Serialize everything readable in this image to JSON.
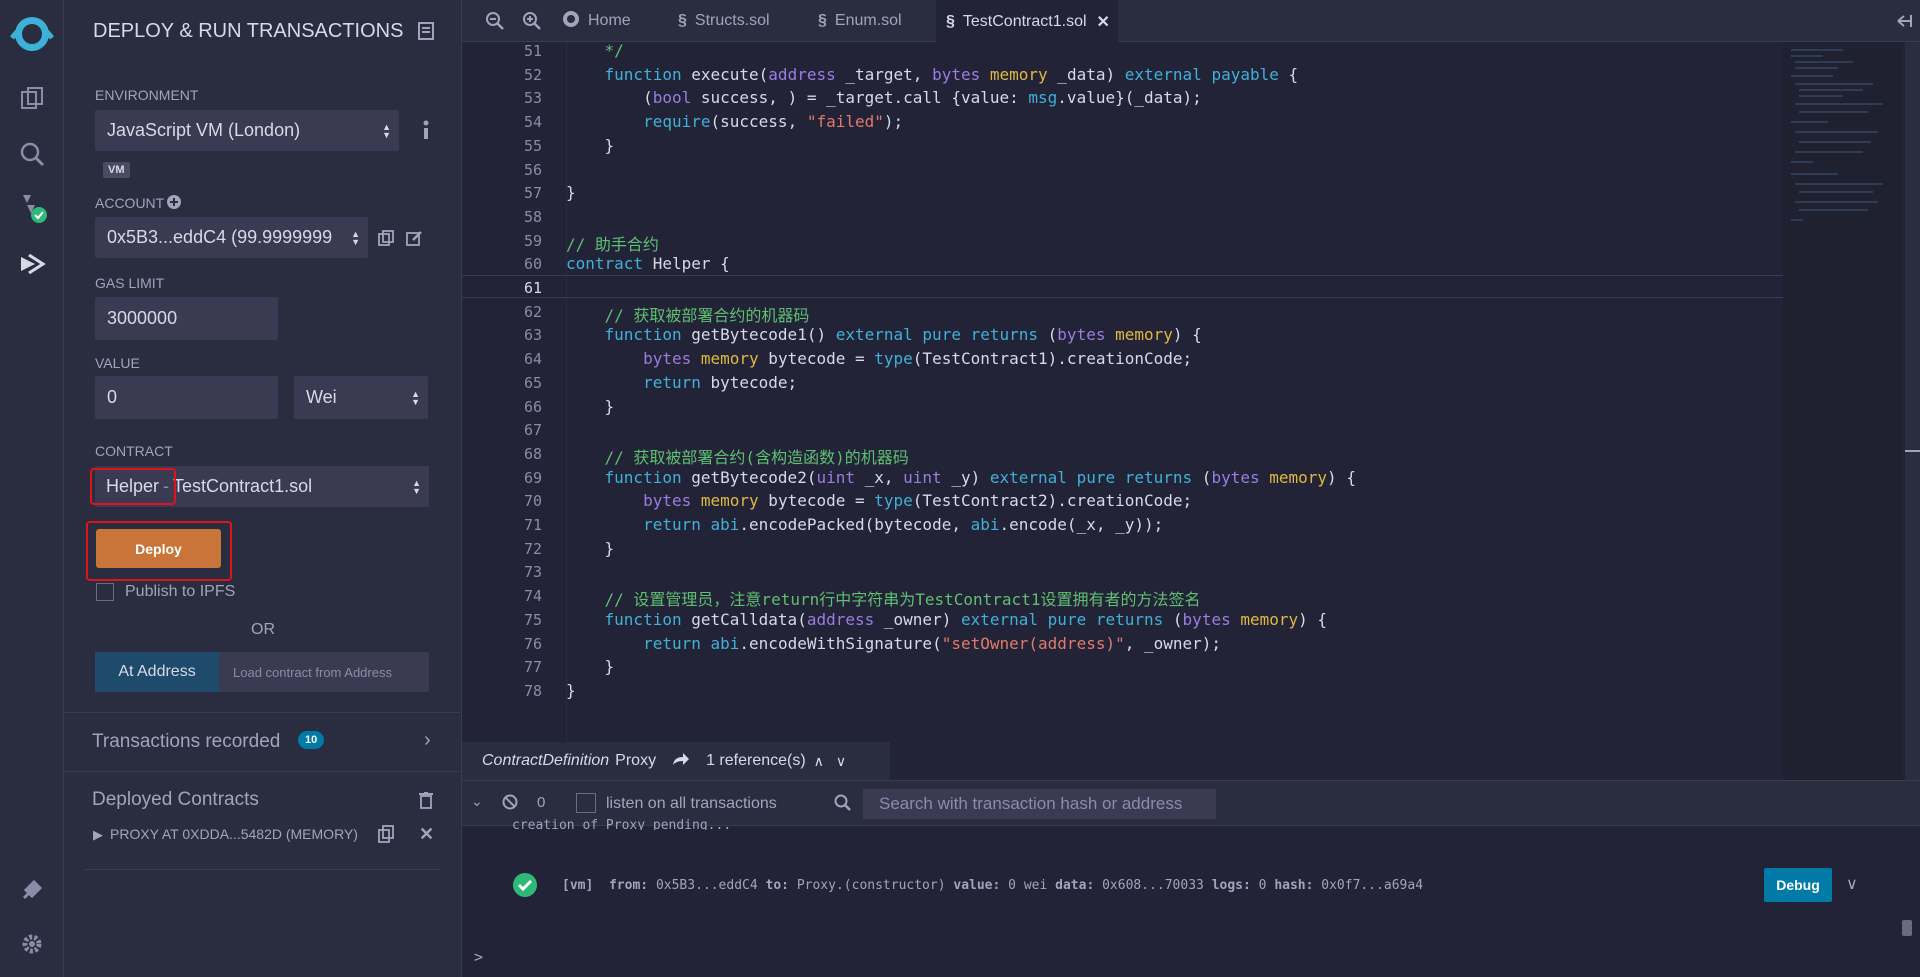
{
  "sidebar_panel": {
    "title": "DEPLOY & RUN TRANSACTIONS",
    "environment_label": "ENVIRONMENT",
    "environment_value": "JavaScript VM (London)",
    "vm_badge": "VM",
    "account_label": "ACCOUNT",
    "account_value": "0x5B3...eddC4 (99.9999999",
    "gas_limit_label": "GAS LIMIT",
    "gas_limit_value": "3000000",
    "value_label": "VALUE",
    "value_value": "0",
    "value_unit": "Wei",
    "contract_label": "CONTRACT",
    "contract_name": "Helper",
    "contract_sep": "-",
    "contract_file": "TestContract1.sol",
    "deploy_label": "Deploy",
    "publish_label": "Publish to IPFS",
    "or_label": "OR",
    "at_address_label": "At Address",
    "load_placeholder": "Load contract from Address",
    "tx_recorded_label": "Transactions recorded",
    "tx_recorded_count": "10",
    "deployed_label": "Deployed Contracts",
    "deployed_item": "PROXY AT 0XDDA...5482D (MEMORY)"
  },
  "tabs": [
    {
      "label": "Home"
    },
    {
      "label": "Structs.sol"
    },
    {
      "label": "Enum.sol"
    },
    {
      "label": "TestContract1.sol"
    }
  ],
  "editor_lines": [
    {
      "n": "51",
      "t": "    */"
    },
    {
      "n": "52",
      "t": "    function execute(address _target, bytes memory _data) external payable {"
    },
    {
      "n": "53",
      "t": "        (bool success, ) = _target.call {value: msg.value}(_data);"
    },
    {
      "n": "54",
      "t": "        require(success, \"failed\");"
    },
    {
      "n": "55",
      "t": "    }"
    },
    {
      "n": "56",
      "t": ""
    },
    {
      "n": "57",
      "t": "}"
    },
    {
      "n": "58",
      "t": ""
    },
    {
      "n": "59",
      "t": "// 助手合约"
    },
    {
      "n": "60",
      "t": "contract Helper {"
    },
    {
      "n": "61",
      "t": ""
    },
    {
      "n": "62",
      "t": "    // 获取被部署合约的机器码"
    },
    {
      "n": "63",
      "t": "    function getBytecode1() external pure returns (bytes memory) {"
    },
    {
      "n": "64",
      "t": "        bytes memory bytecode = type(TestContract1).creationCode;"
    },
    {
      "n": "65",
      "t": "        return bytecode;"
    },
    {
      "n": "66",
      "t": "    }"
    },
    {
      "n": "67",
      "t": ""
    },
    {
      "n": "68",
      "t": "    // 获取被部署合约(含构造函数)的机器码"
    },
    {
      "n": "69",
      "t": "    function getBytecode2(uint _x, uint _y) external pure returns (bytes memory) {"
    },
    {
      "n": "70",
      "t": "        bytes memory bytecode = type(TestContract2).creationCode;"
    },
    {
      "n": "71",
      "t": "        return abi.encodePacked(bytecode, abi.encode(_x, _y));"
    },
    {
      "n": "72",
      "t": "    }"
    },
    {
      "n": "73",
      "t": ""
    },
    {
      "n": "74",
      "t": "    // 设置管理员，注意return行中字符串为TestContract1设置拥有者的方法签名"
    },
    {
      "n": "75",
      "t": "    function getCalldata(address _owner) external pure returns (bytes memory) {"
    },
    {
      "n": "76",
      "t": "        return abi.encodeWithSignature(\"setOwner(address)\", _owner);"
    },
    {
      "n": "77",
      "t": "    }"
    },
    {
      "n": "78",
      "t": "}"
    }
  ],
  "refbar": {
    "kind": "ContractDefinition",
    "name": "Proxy",
    "refs": "1 reference(s)"
  },
  "terminal": {
    "count": "0",
    "listen_label": "listen on all transactions",
    "search_placeholder": "Search with transaction hash or address",
    "cut_line": "creation of Proxy pending...",
    "log_prefix": "[vm]",
    "from_k": "from:",
    "from_v": "0x5B3...eddC4",
    "to_k": "to:",
    "to_v": "Proxy.(constructor)",
    "value_k": "value:",
    "value_v": "0 wei",
    "data_k": "data:",
    "data_v": "0x608...70033",
    "logs_k": "logs:",
    "logs_v": "0",
    "hash_k": "hash:",
    "hash_v": "0x0f7...a69a4",
    "debug_label": "Debug",
    "prompt": ">"
  },
  "colors": {
    "accent": "#007aa6",
    "deploy": "#c97539",
    "highlight": "#e0131a",
    "success": "#2fb978"
  }
}
